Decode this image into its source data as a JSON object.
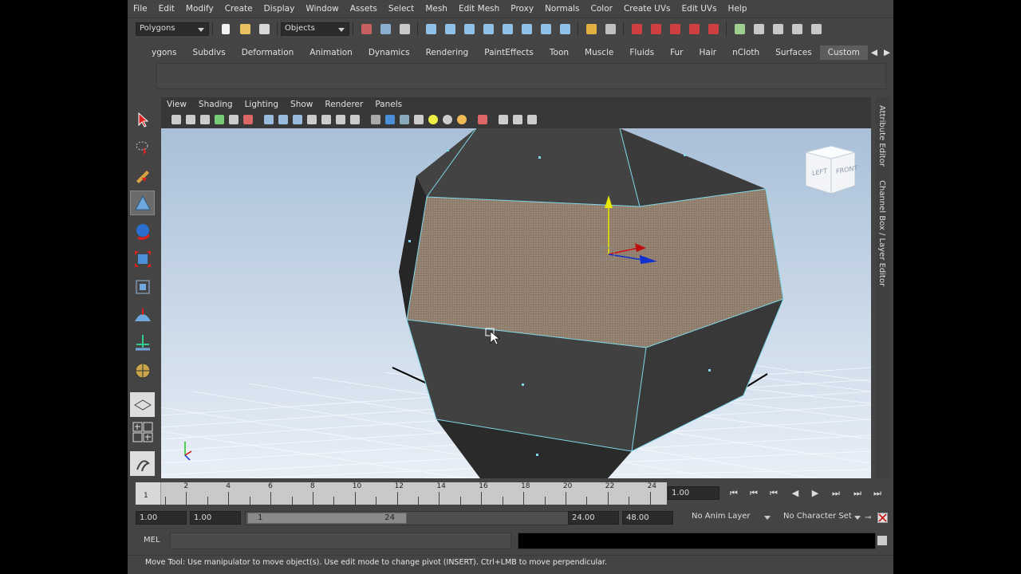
{
  "menubar": [
    "File",
    "Edit",
    "Modify",
    "Create",
    "Display",
    "Window",
    "Assets",
    "Select",
    "Mesh",
    "Edit Mesh",
    "Proxy",
    "Normals",
    "Color",
    "Create UVs",
    "Edit UVs",
    "Help"
  ],
  "status": {
    "menuset": "Polygons",
    "selmode": "Objects"
  },
  "shelf_tabs": [
    "ygons",
    "Subdivs",
    "Deformation",
    "Animation",
    "Dynamics",
    "Rendering",
    "PaintEffects",
    "Toon",
    "Muscle",
    "Fluids",
    "Fur",
    "Hair",
    "nCloth",
    "Surfaces",
    "Custom"
  ],
  "viewport": {
    "menu": [
      "View",
      "Shading",
      "Lighting",
      "Show",
      "Renderer",
      "Panels"
    ],
    "viewcube": {
      "left": "LEFT",
      "front": "FRONT"
    }
  },
  "side_tabs": {
    "attr": "Attribute Editor",
    "channel": "Channel Box / Layer Editor"
  },
  "timeline": {
    "start_label": "1",
    "ticks": [
      "2",
      "4",
      "6",
      "8",
      "10",
      "12",
      "14",
      "16",
      "18",
      "20",
      "22",
      "24"
    ],
    "current": "1.00"
  },
  "range": {
    "start": "1.00",
    "anim_start": "1.00",
    "range_start": "1",
    "range_end": "24",
    "anim_end": "24.00",
    "end": "48.00",
    "anim_layer": "No Anim Layer",
    "char_set": "No Character Set"
  },
  "mel": {
    "label": "MEL"
  },
  "help": "Move Tool: Use manipulator to move object(s). Use edit mode to change pivot (INSERT).  Ctrl+LMB to move perpendicular.",
  "colors": {
    "bg": "#444444",
    "viewport_top": "#a8bfd6",
    "viewport_bottom": "#e6eef6",
    "mesh": "#3a3a3a",
    "selected_face": "#8c7b6b",
    "edge": "#7fd8e8"
  }
}
